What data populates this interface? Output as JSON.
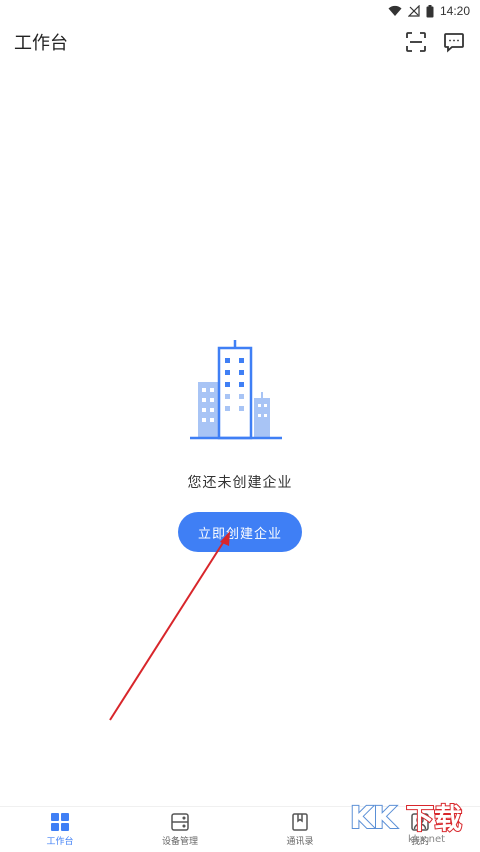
{
  "status_bar": {
    "time": "14:20"
  },
  "header": {
    "title": "工作台"
  },
  "empty_state": {
    "message": "您还未创建企业",
    "button_label": "立即创建企业"
  },
  "tabs": [
    {
      "label": "工作台",
      "icon": "grid-icon",
      "active": true
    },
    {
      "label": "设备管理",
      "icon": "device-icon",
      "active": false
    },
    {
      "label": "通讯录",
      "icon": "contacts-icon",
      "active": false
    },
    {
      "label": "我的",
      "icon": "profile-icon",
      "active": false
    }
  ],
  "watermark": {
    "text": "KK下载",
    "url": "www.kkx.net"
  },
  "colors": {
    "accent": "#3f7ff5",
    "arrow": "#d8262b",
    "illustration_light": "#a8c4f5"
  }
}
